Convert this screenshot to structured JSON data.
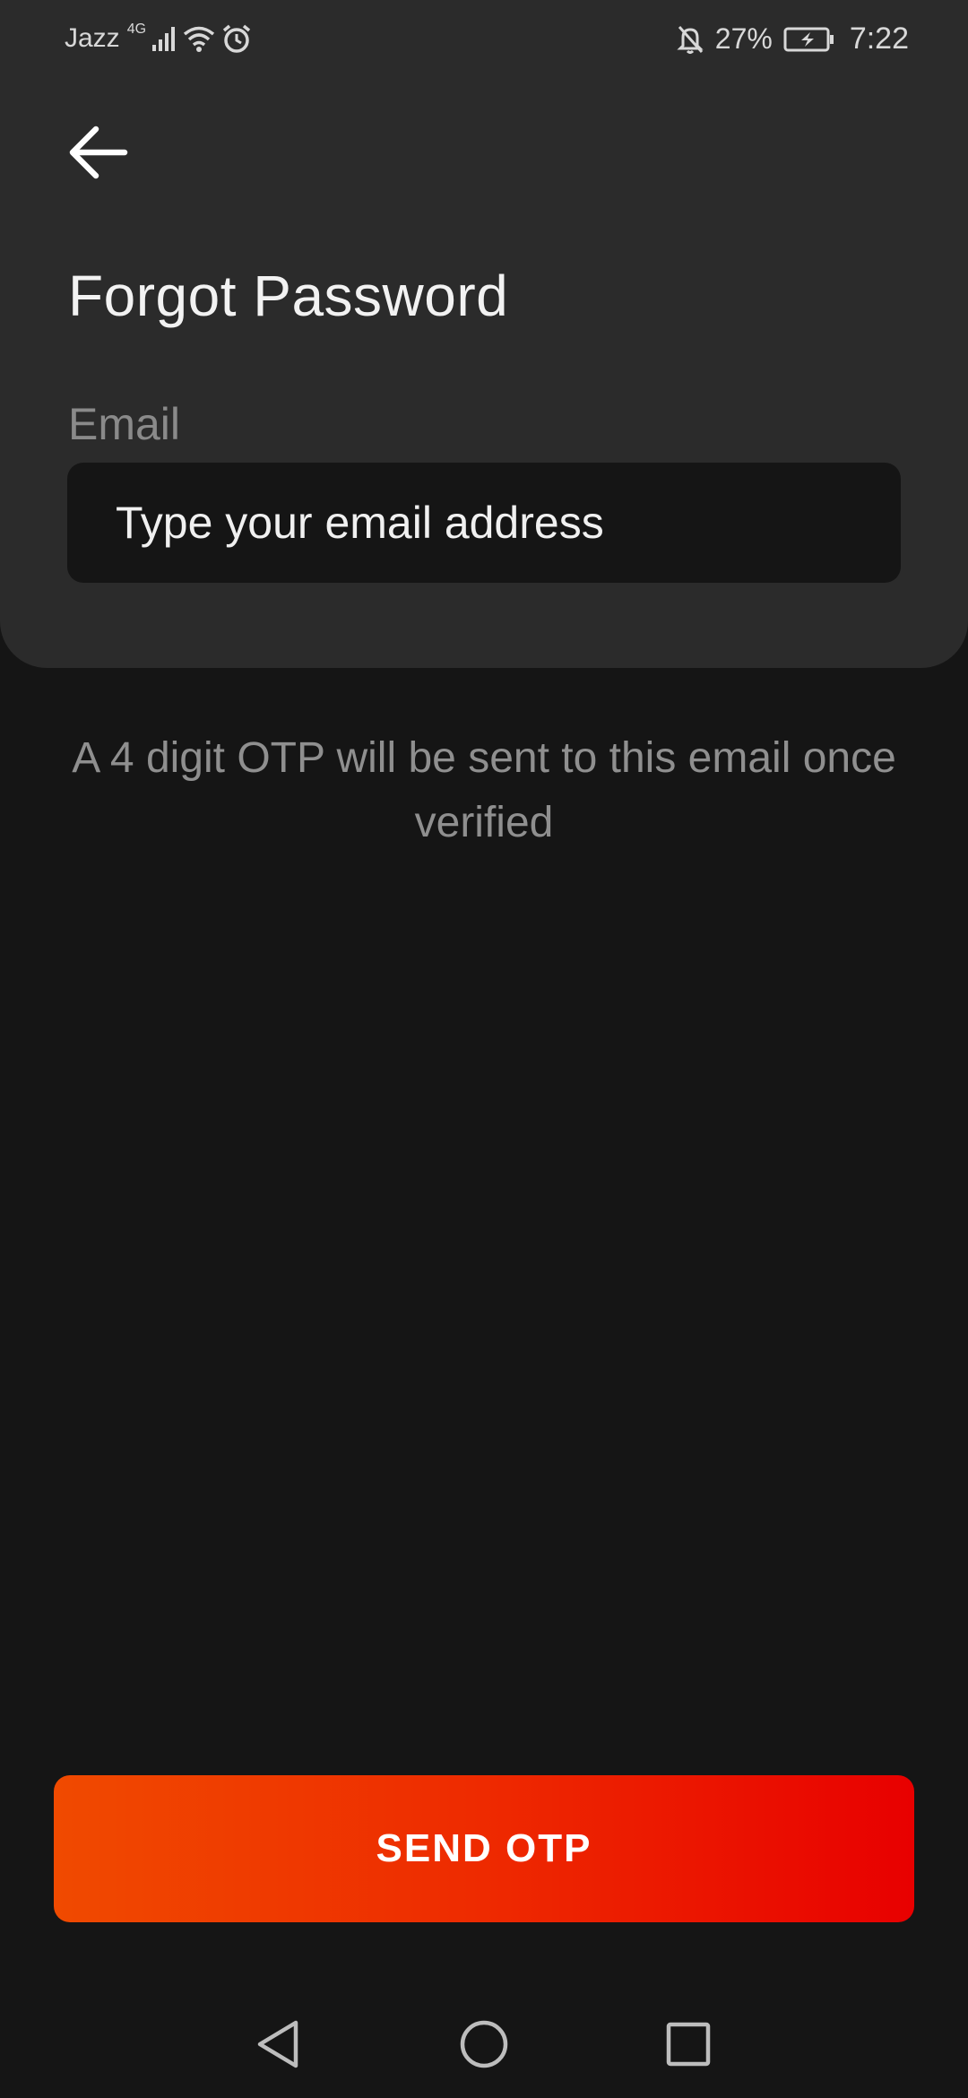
{
  "status_bar": {
    "carrier": "Jazz",
    "network": "4G",
    "battery_percent": "27%",
    "time": "7:22",
    "icons": [
      "signal-icon",
      "wifi-icon",
      "alarm-icon",
      "bell-off-icon",
      "battery-charging-icon"
    ]
  },
  "header": {
    "back_icon": "arrow-left-icon",
    "title": "Forgot Password"
  },
  "form": {
    "email_label": "Email",
    "email_placeholder": "Type your email address",
    "email_value": ""
  },
  "info": {
    "text": "A 4 digit OTP will be sent to this email once verified"
  },
  "actions": {
    "send_otp_label": "SEND OTP"
  },
  "nav_bar": {
    "icons": [
      "nav-back-icon",
      "nav-home-icon",
      "nav-recents-icon"
    ]
  },
  "colors": {
    "background": "#151515",
    "card": "#2b2b2b",
    "button_gradient_start": "#f04a00",
    "button_gradient_end": "#e80000",
    "text_primary": "#f2f2f2",
    "text_secondary": "#8a8a8a"
  }
}
